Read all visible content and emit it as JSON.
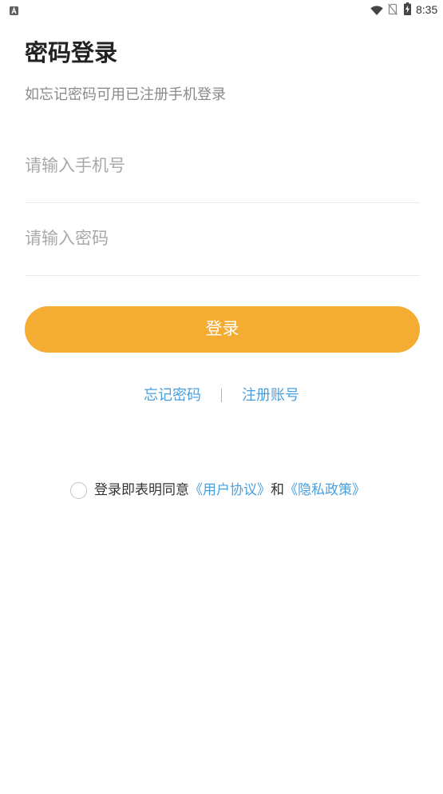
{
  "status_bar": {
    "time": "8:35",
    "icons": {
      "notification": "notification-icon",
      "wifi": "wifi-icon",
      "sim": "no-sim-icon",
      "battery": "battery-charging-icon"
    }
  },
  "header": {
    "title": "密码登录",
    "subtitle": "如忘记密码可用已注册手机登录"
  },
  "form": {
    "phone": {
      "value": "",
      "placeholder": "请输入手机号"
    },
    "password": {
      "value": "",
      "placeholder": "请输入密码"
    },
    "login_label": "登录"
  },
  "links": {
    "forgot_password": "忘记密码",
    "register": "注册账号"
  },
  "agreement": {
    "checked": false,
    "prefix": "登录即表明同意",
    "user_agreement": "《用户协议》",
    "conjunction": "和",
    "privacy_policy": "《隐私政策》"
  },
  "theme": {
    "accent": "#F5AC33",
    "link": "#4A9FDF",
    "divider": "#86BDEA",
    "title": "#222222",
    "subtitle": "#8A8A8A",
    "placeholder": "#A9A9A9",
    "text": "#333333",
    "line": "#EBEBEB",
    "checkbox": "#C4C4C4"
  }
}
